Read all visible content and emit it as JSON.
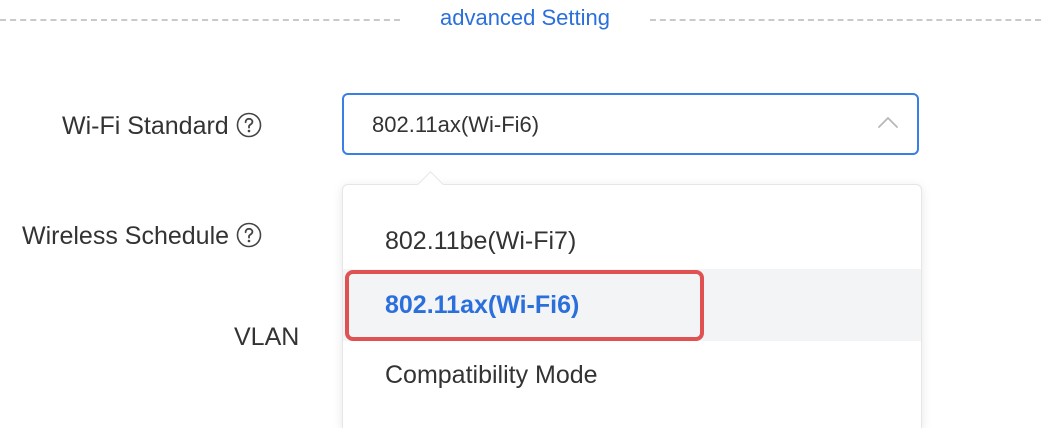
{
  "section": {
    "title": "advanced Setting"
  },
  "form": {
    "wifi_standard_label": "Wi-Fi Standard",
    "wireless_schedule_label": "Wireless Schedule",
    "vlan_label": "VLAN"
  },
  "select": {
    "value": "802.11ax(Wi-Fi6)",
    "expanded": true
  },
  "dropdown": {
    "options": [
      {
        "label": "802.11be(Wi-Fi7)",
        "selected": false
      },
      {
        "label": "802.11ax(Wi-Fi6)",
        "selected": true
      },
      {
        "label": "Compatibility Mode",
        "selected": false
      }
    ]
  },
  "colors": {
    "accent": "#2a6fdb",
    "highlight": "#e05252",
    "text": "#333333"
  },
  "icons": {
    "help": "question-circle-icon",
    "arrow": "chevron-up-icon"
  }
}
